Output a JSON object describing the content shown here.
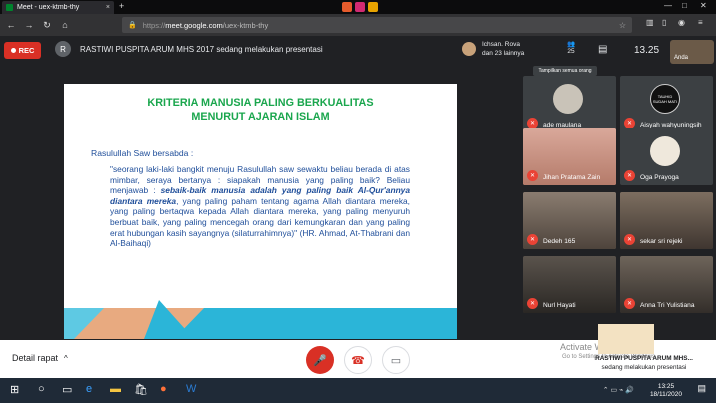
{
  "browser": {
    "tab_title": "Meet - uex-ktmb-thy",
    "tab_close": "×",
    "new_tab": "+",
    "win_min": "—",
    "win_max": "□",
    "win_close": "✕",
    "back": "←",
    "forward": "→",
    "reload": "↻",
    "home": "⌂",
    "url_scheme": "https://",
    "url_host": "meet.google.com",
    "url_path": "/uex-ktmb-thy",
    "star": "☆"
  },
  "meet": {
    "rec_label": "REC",
    "presenter_initial": "R",
    "presenting_text": "RASTIWI PUSPITA ARUM MHS 2017 sedang melakukan presentasi",
    "participants_line1": "Ichsan. Rova",
    "participants_line2": "dan 23 lainnya",
    "people_count": "25",
    "clock": "13.25",
    "self_label": "Anda",
    "tooltip": "Tampilkan semua orang"
  },
  "slide": {
    "title_line1": "KRITERIA MANUSIA PALING BERKUALITAS",
    "title_line2": "MENURUT AJARAN ISLAM",
    "intro": "Rasulullah  Saw bersabda :",
    "body_1": "\"seorang laki-laki bangkit menuju Rasulullah saw sewaktu beliau berada di atas mimbar, seraya bertanya : siapakah manusia yang paling baik? Beliau menjawab : ",
    "body_bold": "sebaik-baik manusia adalah yang paling baik Al-Qur'annya diantara mereka",
    "body_2": ", yang paling paham tentang agama Allah diantara mereka,  yang paling bertaqwa kepada Allah diantara mereka, yang paling menyuruh berbuat baik, yang paling mencegah orang dari kemungkaran dan yang paling erat hubungan kasih sayangnya (silaturrahimnya)\" (HR. Ahmad, At-Thabrani dan Al-Baihaqi)"
  },
  "participants": [
    {
      "name": "ade maulana"
    },
    {
      "name": "Aisyah wahyuningsih"
    },
    {
      "name": "Jihan Pratama Zain"
    },
    {
      "name": "Oga Prayoga"
    },
    {
      "name": "Dedeh 165"
    },
    {
      "name": "sekar sri rejeki"
    },
    {
      "name": "Nurl Hayati"
    },
    {
      "name": "Anna Tri Yulistiana"
    }
  ],
  "tile_badges": {
    "tauhid_line1": "TAUHID",
    "tauhid_line2": "SUDAH MATI"
  },
  "bottom": {
    "details_label": "Detail rapat",
    "details_chevron": "^",
    "mic_icon": "🎤",
    "hangup_icon": "☎",
    "cam_icon": "▭",
    "activate_line1": "Activate Windows",
    "activate_line2": "Go to Settings to activate Windows.",
    "presenting_name": "RASTIWI PUSPITA ARUM MHS...",
    "presenting_sub": "sedang melakukan presentasi"
  },
  "taskbar": {
    "time": "13:25",
    "date": "18/11/2020"
  }
}
